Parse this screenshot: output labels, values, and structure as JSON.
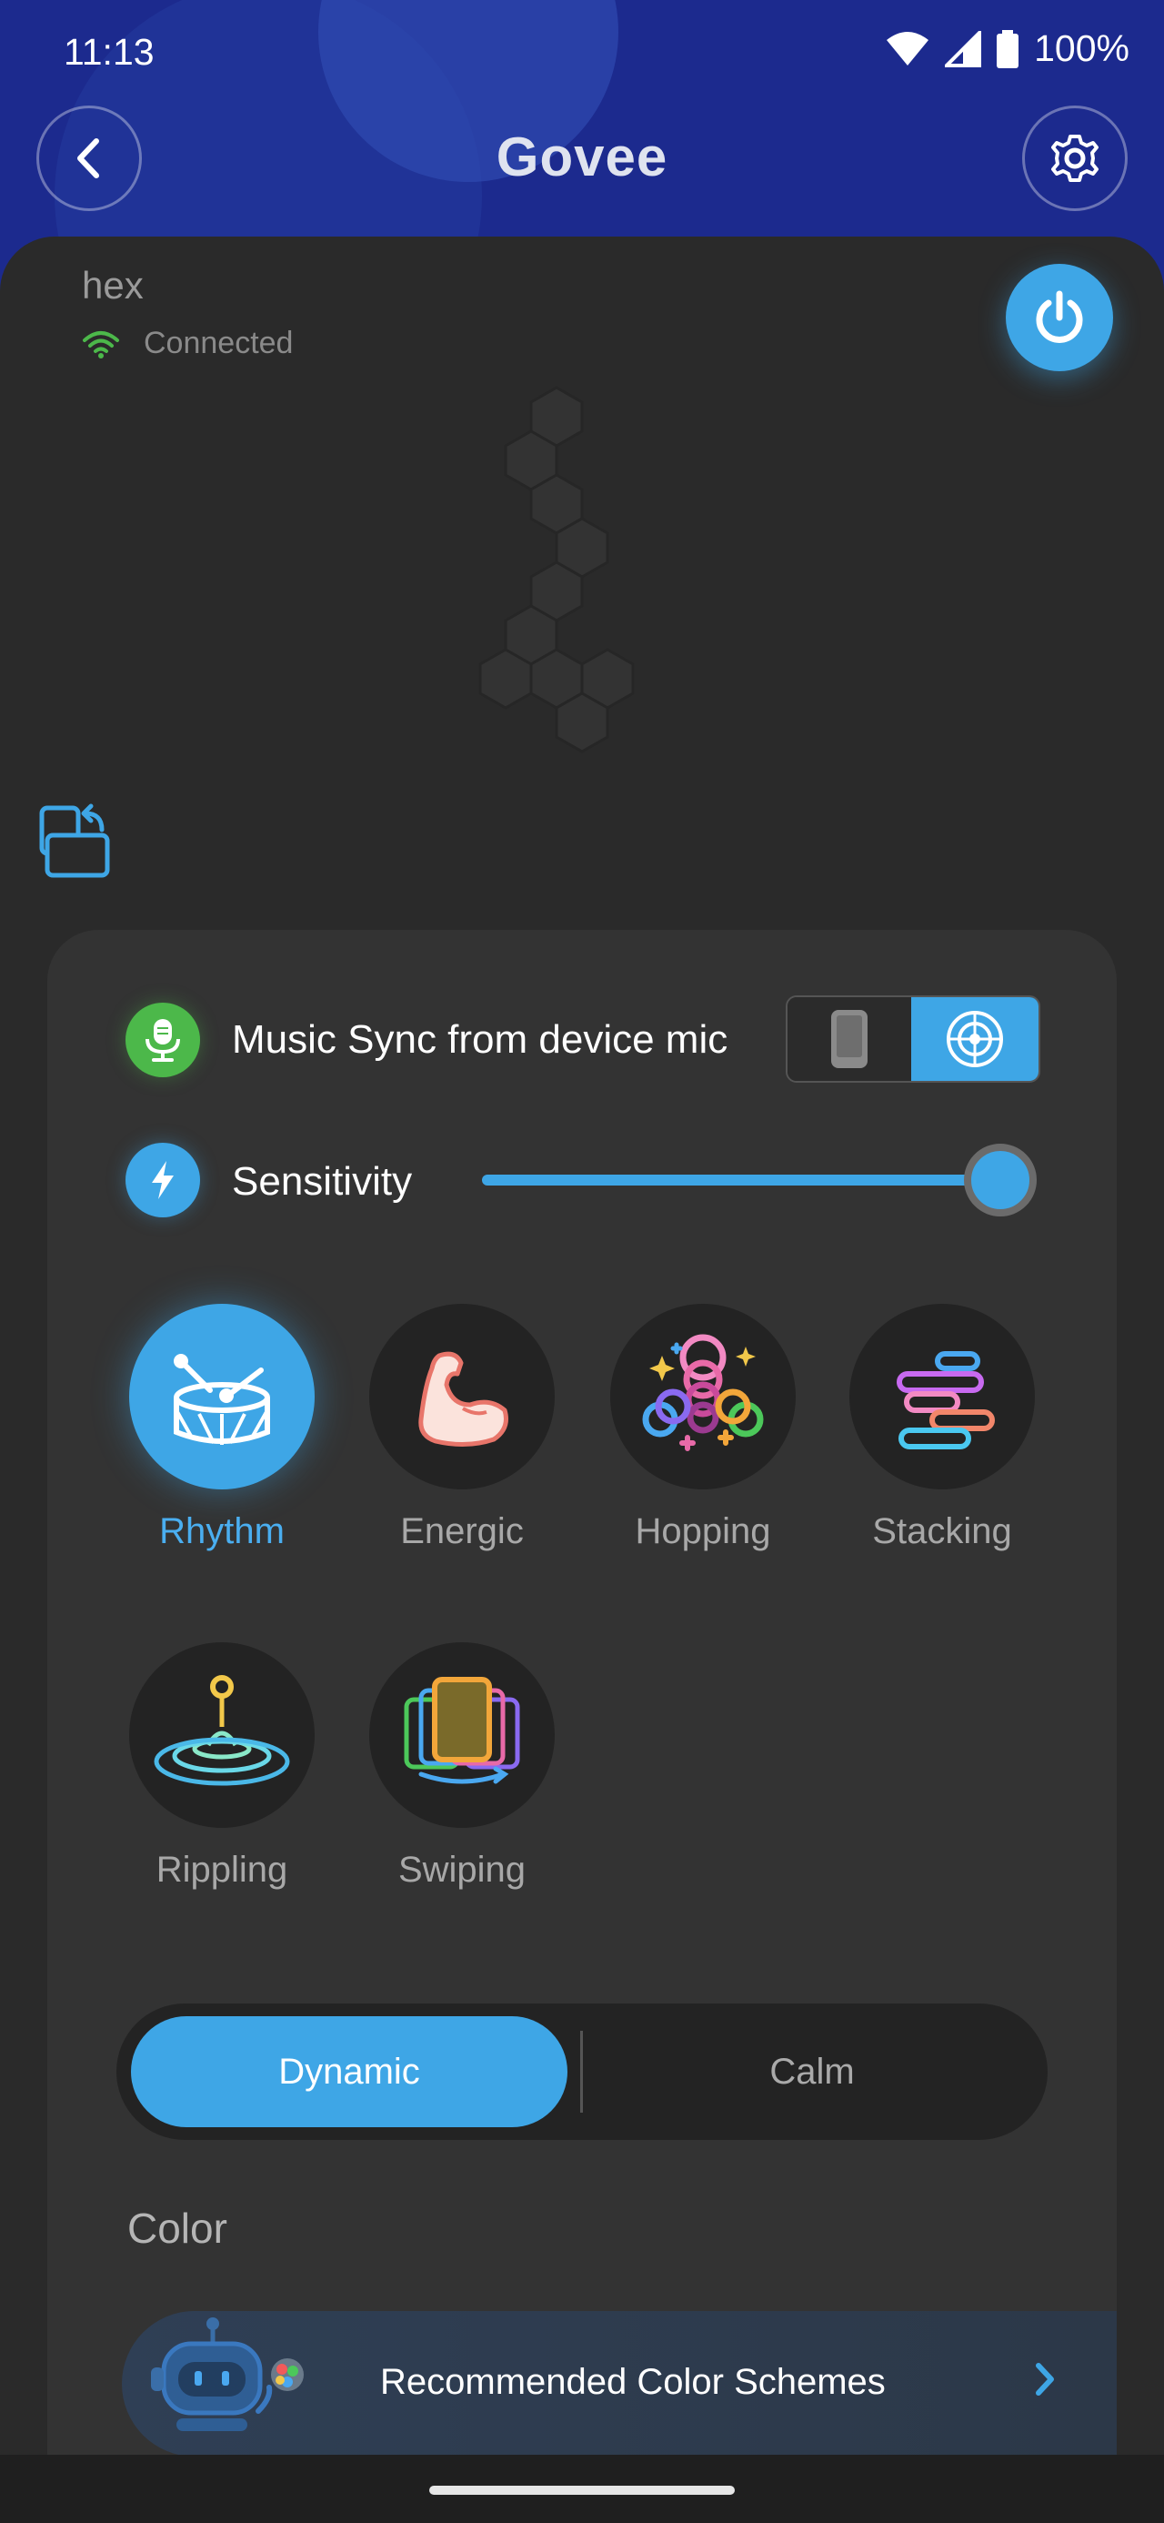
{
  "status_bar": {
    "time": "11:13",
    "battery": "100%"
  },
  "header": {
    "logo": "Govee"
  },
  "device": {
    "name": "hex",
    "connection_status": "Connected"
  },
  "music": {
    "source_label": "Music Sync from device mic",
    "sensitivity_label": "Sensitivity",
    "sensitivity_value": 1.0,
    "modes": [
      {
        "label": "Rhythm",
        "icon": "drum-icon",
        "active": true
      },
      {
        "label": "Energic",
        "icon": "flexed-arm-icon",
        "active": false
      },
      {
        "label": "Hopping",
        "icon": "hopping-rings-icon",
        "active": false
      },
      {
        "label": "Stacking",
        "icon": "stacking-bars-icon",
        "active": false
      },
      {
        "label": "Rippling",
        "icon": "ripple-icon",
        "active": false
      },
      {
        "label": "Swiping",
        "icon": "swipe-cards-icon",
        "active": false
      }
    ],
    "style_options": [
      "Dynamic",
      "Calm"
    ],
    "style_selected": "Dynamic"
  },
  "color": {
    "title": "Color",
    "recommended_label": "Recommended Color Schemes"
  },
  "colors": {
    "accent": "#3ea6e6",
    "header_bg": "#1c2a8e",
    "mic_green": "#4cb84a"
  }
}
